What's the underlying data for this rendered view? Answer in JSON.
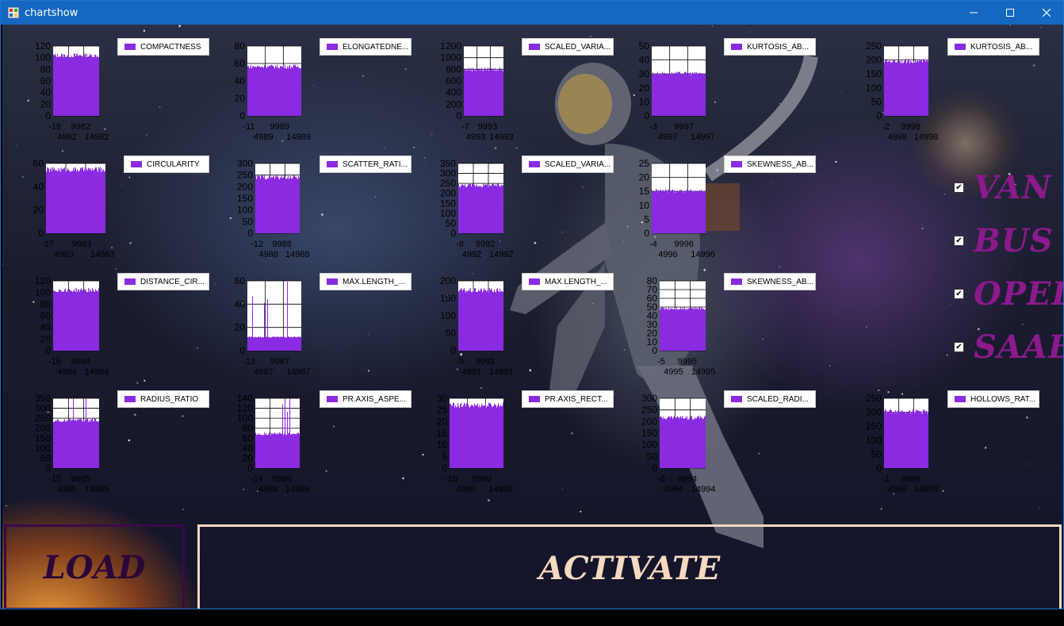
{
  "window": {
    "title": "chartshow"
  },
  "colors": {
    "bar": "#8a2be2",
    "titlebar": "#1468c0",
    "check_label": "#8b1a8b",
    "activate": "#f6d9bf"
  },
  "checks": [
    {
      "label": "VAN",
      "checked": true
    },
    {
      "label": "BUS",
      "checked": true
    },
    {
      "label": "OPEL",
      "checked": true
    },
    {
      "label": "SAAB",
      "checked": true
    }
  ],
  "buttons": {
    "load": "LOAD",
    "activate": "ACTIVATE"
  },
  "chart_data": [
    {
      "type": "bar",
      "name": "COMPACTNESS",
      "yticks": [
        "0",
        "20",
        "40",
        "60",
        "80",
        "100",
        "120"
      ],
      "xticks": [
        "-18",
        "9982",
        "4982",
        "14982"
      ],
      "ymax": 120,
      "fill": 0.88,
      "spikes": false
    },
    {
      "type": "bar",
      "name": "ELONGATEDNE...",
      "yticks": [
        "0",
        "20",
        "40",
        "60",
        "80"
      ],
      "xticks": [
        "-11",
        "9989",
        "4989",
        "14989"
      ],
      "ymax": 80,
      "fill": 0.72,
      "spikes": false
    },
    {
      "type": "bar",
      "name": "SCALED_VARIA...",
      "yticks": [
        "0",
        "200",
        "400",
        "600",
        "800",
        "1000",
        "1200"
      ],
      "xticks": [
        "-7",
        "9993",
        "4993",
        "14993"
      ],
      "ymax": 1200,
      "fill": 0.68,
      "spikes": false
    },
    {
      "type": "bar",
      "name": "KURTOSIS_AB...",
      "yticks": [
        "0",
        "10",
        "20",
        "30",
        "40",
        "50"
      ],
      "xticks": [
        "-3",
        "9997",
        "4997",
        "14997"
      ],
      "ymax": 50,
      "fill": 0.62,
      "spikes": false
    },
    {
      "type": "bar",
      "name": "KURTOSIS_AB...",
      "yticks": [
        "0",
        "50",
        "100",
        "150",
        "200",
        "250"
      ],
      "xticks": [
        "-2",
        "9998",
        "4998",
        "14998"
      ],
      "ymax": 250,
      "fill": 0.8,
      "spikes": false
    },
    {
      "type": "bar",
      "name": "CIRCULARITY",
      "yticks": [
        "0",
        "20",
        "40",
        "60"
      ],
      "xticks": [
        "-17",
        "9983",
        "4983",
        "14983"
      ],
      "ymax": 60,
      "fill": 0.93,
      "spikes": false
    },
    {
      "type": "bar",
      "name": "SCATTER_RATI...",
      "yticks": [
        "0",
        "50",
        "100",
        "150",
        "200",
        "250",
        "300"
      ],
      "xticks": [
        "-12",
        "9988",
        "4988",
        "14988"
      ],
      "ymax": 300,
      "fill": 0.82,
      "spikes": false
    },
    {
      "type": "bar",
      "name": "SCALED_VARIA...",
      "yticks": [
        "0",
        "50",
        "100",
        "150",
        "200",
        "250",
        "300",
        "350"
      ],
      "xticks": [
        "-8",
        "9992",
        "4992",
        "14992"
      ],
      "ymax": 350,
      "fill": 0.7,
      "spikes": false
    },
    {
      "type": "bar",
      "name": "SKEWNESS_AB...",
      "yticks": [
        "0",
        "5",
        "10",
        "15",
        "20",
        "25"
      ],
      "xticks": [
        "-4",
        "9996",
        "4996",
        "14996"
      ],
      "ymax": 25,
      "fill": 0.62,
      "spikes": false
    },
    {
      "type": "bar",
      "name": "DISTANCE_CIR...",
      "yticks": [
        "0",
        "20",
        "40",
        "60",
        "80",
        "100",
        "120"
      ],
      "xticks": [
        "-16",
        "9984",
        "4984",
        "14984"
      ],
      "ymax": 120,
      "fill": 0.88,
      "spikes": false
    },
    {
      "type": "bar",
      "name": "MAX.LENGTH_...",
      "yticks": [
        "0",
        "20",
        "40",
        "60"
      ],
      "xticks": [
        "-13",
        "9987",
        "4987",
        "14987"
      ],
      "ymax": 60,
      "fill": 0.2,
      "spikes": true
    },
    {
      "type": "bar",
      "name": "MAX.LENGTH_...",
      "yticks": [
        "0",
        "50",
        "100",
        "150",
        "200"
      ],
      "xticks": [
        "-9",
        "9991",
        "4991",
        "14991"
      ],
      "ymax": 200,
      "fill": 0.88,
      "spikes": false
    },
    {
      "type": "bar",
      "name": "SKEWNESS_AB...",
      "yticks": [
        "0",
        "10",
        "20",
        "30",
        "40",
        "50",
        "60",
        "70",
        "80"
      ],
      "xticks": [
        "-5",
        "9995",
        "4995",
        "14995"
      ],
      "ymax": 80,
      "fill": 0.62,
      "spikes": false
    },
    {
      "type": "bar",
      "name": "RADIUS_RATIO",
      "yticks": [
        "0",
        "50",
        "100",
        "150",
        "200",
        "250",
        "300",
        "350"
      ],
      "xticks": [
        "-15",
        "9985",
        "4985",
        "14985"
      ],
      "ymax": 350,
      "fill": 0.7,
      "spikes": true
    },
    {
      "type": "bar",
      "name": "PR.AXIS_ASPE...",
      "yticks": [
        "0",
        "20",
        "40",
        "60",
        "80",
        "100",
        "120",
        "140"
      ],
      "xticks": [
        "-14",
        "9986",
        "4986",
        "14986"
      ],
      "ymax": 140,
      "fill": 0.5,
      "spikes": true
    },
    {
      "type": "bar",
      "name": "PR.AXIS_RECT...",
      "yticks": [
        "0",
        "5",
        "10",
        "15",
        "20",
        "25",
        "30"
      ],
      "xticks": [
        "-10",
        "9990",
        "4990",
        "14990"
      ],
      "ymax": 30,
      "fill": 0.92,
      "spikes": false
    },
    {
      "type": "bar",
      "name": "SCALED_RADI...",
      "yticks": [
        "0",
        "50",
        "100",
        "150",
        "200",
        "250",
        "300"
      ],
      "xticks": [
        "-6",
        "9994",
        "4994",
        "14994"
      ],
      "ymax": 300,
      "fill": 0.74,
      "spikes": false
    },
    {
      "type": "bar",
      "name": "HOLLOWS_RAT...",
      "yticks": [
        "0",
        "50",
        "100",
        "150",
        "200",
        "250"
      ],
      "xticks": [
        "-1",
        "9999",
        "4999",
        "14999"
      ],
      "ymax": 250,
      "fill": 0.83,
      "spikes": false
    }
  ]
}
